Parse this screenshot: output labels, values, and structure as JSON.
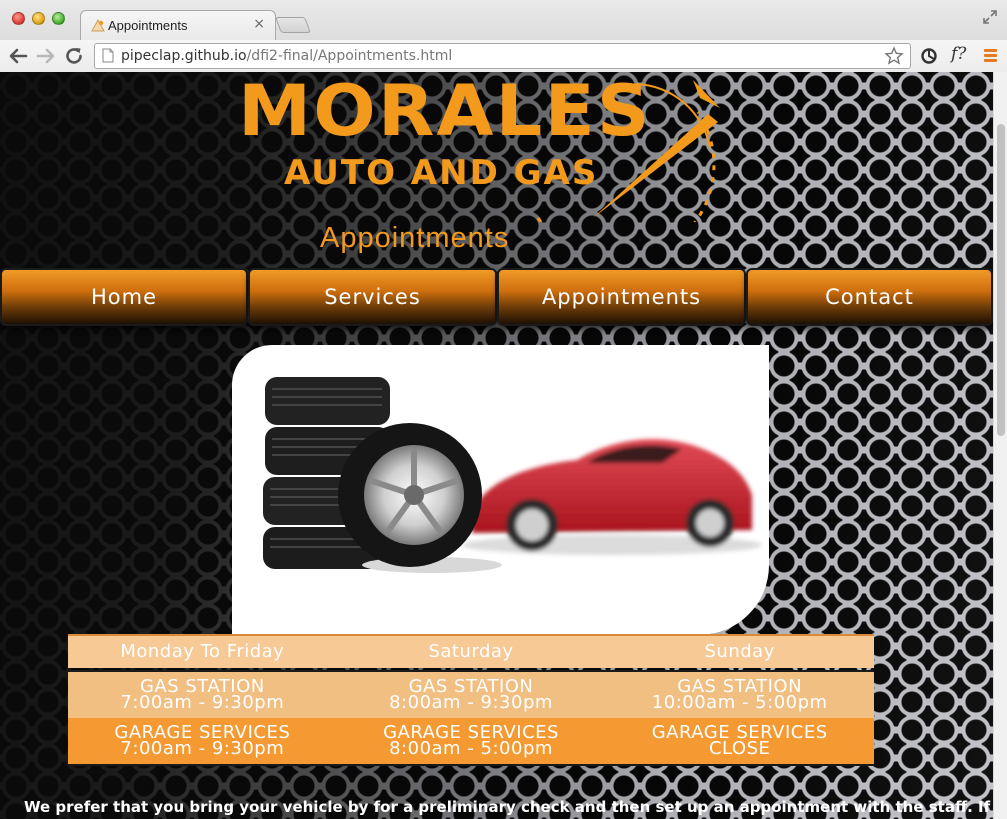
{
  "browser": {
    "tab_title": "Appointments",
    "tab_close": "×",
    "url_host": "pipeclap.github.io",
    "url_path": "/dfi2-final/Appointments.html",
    "extension_label": "f?"
  },
  "site": {
    "logo_line1": "MORALES",
    "logo_line2": "AUTO AND GAS",
    "page_heading": "Appointments",
    "accent_color": "#f39a1c"
  },
  "nav": {
    "items": [
      {
        "label": "Home"
      },
      {
        "label": "Services"
      },
      {
        "label": "Appointments"
      },
      {
        "label": "Contact"
      }
    ]
  },
  "hours": {
    "headers": [
      "Monday To Friday",
      "Saturday",
      "Sunday"
    ],
    "gas_station": [
      {
        "title": "GAS STATION",
        "time": "7:00am - 9:30pm"
      },
      {
        "title": "GAS STATION",
        "time": "8:00am - 9:30pm"
      },
      {
        "title": "GAS STATION",
        "time": "10:00am - 5:00pm"
      }
    ],
    "garage_services": [
      {
        "title": "GARAGE SERVICES",
        "time": "7:00am - 9:30pm"
      },
      {
        "title": "GARAGE SERVICES",
        "time": "8:00am - 5:00pm"
      },
      {
        "title": "GARAGE SERVICES",
        "time": "CLOSE"
      }
    ]
  },
  "content": {
    "intro_text": "We prefer that you bring your vehicle by for a preliminary check and then set up an appointment with the staff. If"
  }
}
